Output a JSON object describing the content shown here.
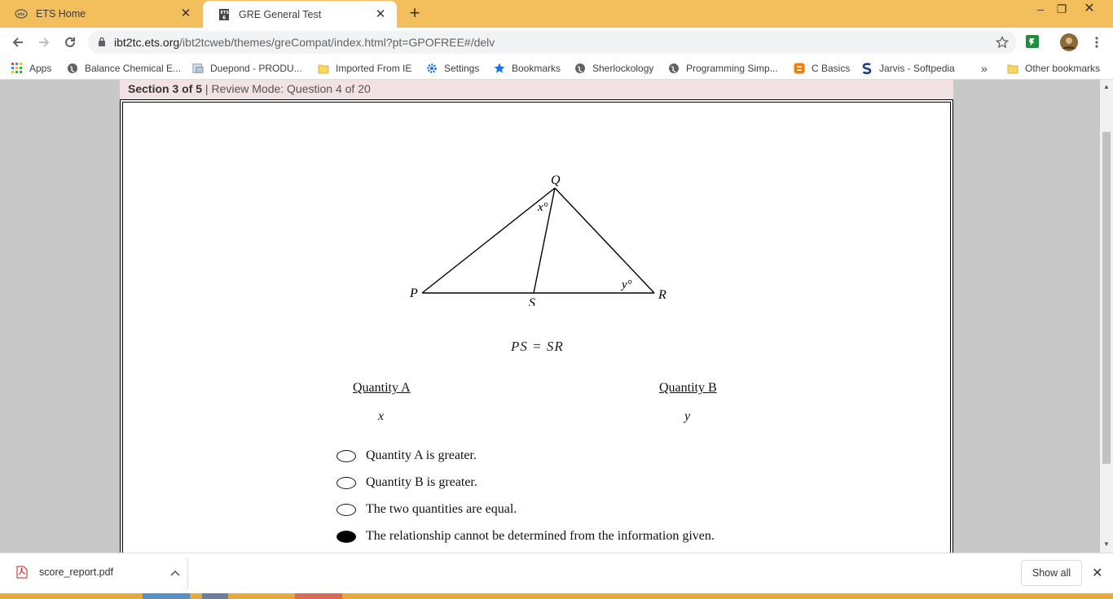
{
  "tabs": [
    {
      "title": "ETS Home",
      "active": false
    },
    {
      "title": "GRE General Test",
      "active": true
    }
  ],
  "toolbar": {
    "url_host": "ibt2tc.ets.org",
    "url_path": "/ibt2tcweb/themes/greCompat/index.html?pt=GPOFREE#/delv"
  },
  "bookmarks": [
    {
      "label": "Apps",
      "icon": "apps-grid-icon"
    },
    {
      "label": "Balance Chemical E...",
      "icon": "globe-icon"
    },
    {
      "label": "Duepond - PRODU...",
      "icon": "page-icon"
    },
    {
      "label": "Imported From IE",
      "icon": "folder-icon"
    },
    {
      "label": "Settings",
      "icon": "gear-icon"
    },
    {
      "label": "Bookmarks",
      "icon": "star-icon"
    },
    {
      "label": "Sherlockology",
      "icon": "globe-icon"
    },
    {
      "label": "Programming Simp...",
      "icon": "globe-icon"
    },
    {
      "label": "C Basics",
      "icon": "blogger-icon"
    },
    {
      "label": "Jarvis - Softpedia",
      "icon": "softpedia-icon"
    },
    {
      "label": "Other bookmarks",
      "icon": "folder-icon"
    }
  ],
  "overflow_label": "»",
  "section": {
    "prefix": "Section 3 of 5",
    "mode": " | Review Mode: Question 4 of 20"
  },
  "figure": {
    "vertex_q": "Q",
    "vertex_p": "P",
    "vertex_r": "R",
    "vertex_s": "S",
    "angle_x": "x°",
    "angle_y": "y°"
  },
  "equation": "PS = SR",
  "quantity_a": {
    "heading": "Quantity A",
    "value": "x"
  },
  "quantity_b": {
    "heading": "Quantity B",
    "value": "y"
  },
  "choices": [
    {
      "label": "Quantity A is greater.",
      "selected": false
    },
    {
      "label": "Quantity B is greater.",
      "selected": false
    },
    {
      "label": "The two quantities are equal.",
      "selected": false
    },
    {
      "label": "The relationship cannot be determined from the information given.",
      "selected": true
    }
  ],
  "downloads": {
    "file": "score_report.pdf",
    "show_all": "Show all"
  },
  "colors": {
    "tabstrip": "#f2bf5c",
    "section_bar": "#f2e2e4",
    "page_bg": "#c8c8c8"
  }
}
